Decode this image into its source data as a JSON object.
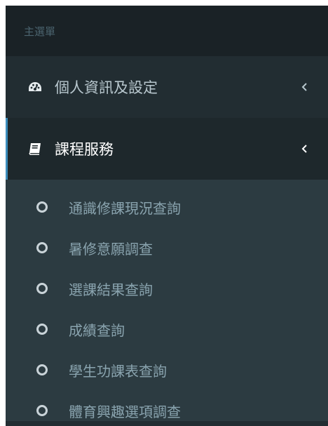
{
  "sidebar": {
    "header": "主選單",
    "menu": [
      {
        "label": "個人資訊及設定",
        "icon": "dashboard-icon",
        "expanded": false
      },
      {
        "label": "課程服務",
        "icon": "book-icon",
        "expanded": true
      }
    ],
    "submenu": [
      {
        "label": "通識修課現況查詢"
      },
      {
        "label": "暑修意願調查"
      },
      {
        "label": "選課結果查詢"
      },
      {
        "label": "成績查詢"
      },
      {
        "label": "學生功課表查詢"
      },
      {
        "label": "體育興趣選項調查"
      }
    ]
  },
  "colors": {
    "sidebar_bg": "#222d32",
    "header_bg": "#1a2226",
    "active_bg": "#1e282c",
    "submenu_bg": "#2c3b41",
    "accent": "#3c8dbc"
  }
}
